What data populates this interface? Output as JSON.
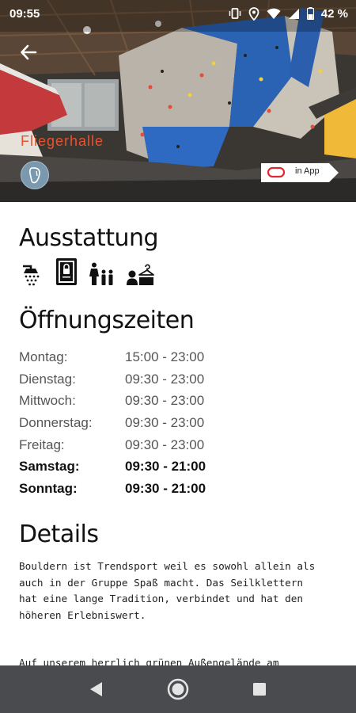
{
  "status_bar": {
    "time": "09:55",
    "battery": "42 %"
  },
  "header": {
    "hall_name": "Fliegerhalle",
    "in_app_label": "in App"
  },
  "equipment": {
    "title": "Ausstattung",
    "icons": [
      "shower-icon",
      "locker-icon",
      "family-icon",
      "wardrobe-icon"
    ]
  },
  "hours": {
    "title": "Öffnungszeiten",
    "rows": [
      {
        "day": "Montag:",
        "time": "15:00 - 23:00"
      },
      {
        "day": "Dienstag:",
        "time": "09:30 - 23:00"
      },
      {
        "day": "Mittwoch:",
        "time": "09:30 - 23:00"
      },
      {
        "day": "Donnerstag:",
        "time": "09:30 - 23:00"
      },
      {
        "day": "Freitag:",
        "time": "09:30 - 23:00"
      },
      {
        "day": "Samstag:",
        "time": "09:30 - 21:00"
      },
      {
        "day": "Sonntag:",
        "time": "09:30 - 21:00"
      }
    ]
  },
  "details": {
    "title": "Details",
    "lines": [
      "Bouldern ist Trendsport weil es sowohl allein als",
      "auch in der Gruppe Spaß macht. Das Seilklettern",
      "hat eine lange Tradition, verbindet und hat den",
      "höheren Erlebniswert."
    ],
    "cut_line": "Auf unserem herrlich grünen Außengelände am"
  },
  "colors": {
    "accent": "#e8532f",
    "navbar": "#4a4b4e",
    "badge": "#7b99ae"
  }
}
